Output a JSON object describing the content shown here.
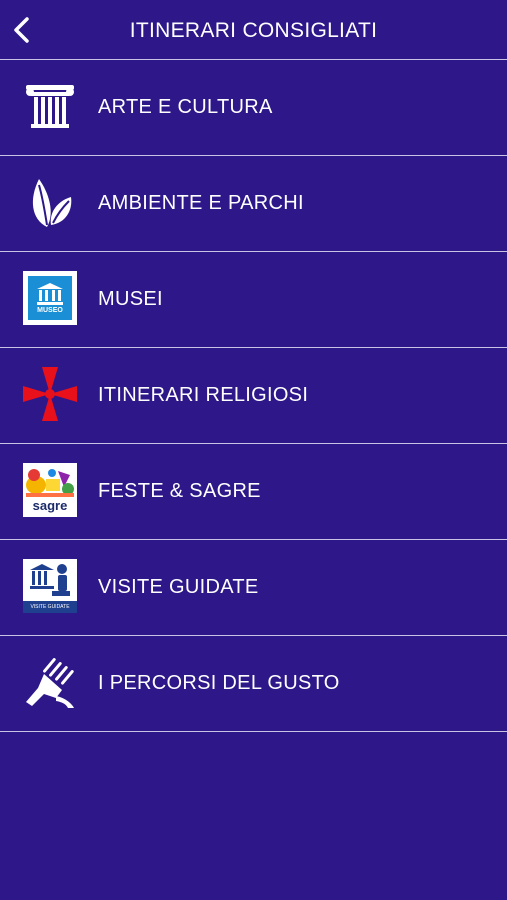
{
  "header": {
    "title": "ITINERARI CONSIGLIATI",
    "back_icon": "chevron-left-icon"
  },
  "menu": {
    "items": [
      {
        "label": "ARTE E CULTURA",
        "icon": "column-icon"
      },
      {
        "label": "AMBIENTE E PARCHI",
        "icon": "leaves-icon"
      },
      {
        "label": "MUSEI",
        "icon": "museum-badge-icon",
        "badge_text": "MUSEO"
      },
      {
        "label": "ITINERARI RELIGIOSI",
        "icon": "red-cross-icon"
      },
      {
        "label": "FESTE & SAGRE",
        "icon": "festival-badge-icon",
        "badge_text": "sagre"
      },
      {
        "label": "VISITE GUIDATE",
        "icon": "guided-tour-badge-icon",
        "badge_text": "VISITE GUIDATE"
      },
      {
        "label": "I PERCORSI DEL GUSTO",
        "icon": "fork-hand-icon"
      }
    ]
  },
  "colors": {
    "background": "#2e1789",
    "divider": "#c9c4e6",
    "museum_blue": "#1a8fd6",
    "guided_navy": "#1f3f8f",
    "cross_red": "#e8101a"
  }
}
